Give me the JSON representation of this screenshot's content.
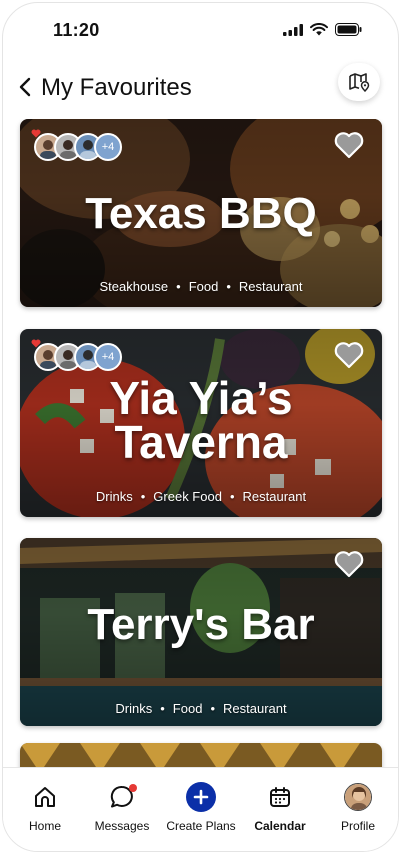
{
  "status_bar": {
    "time": "11:20"
  },
  "header": {
    "title": "My Favourites"
  },
  "cards": [
    {
      "name": "Texas BBQ",
      "tags": [
        "Steakhouse",
        "Food",
        "Restaurant"
      ],
      "avatar_more": "+4",
      "liked": true
    },
    {
      "name": "Yia Yia’s Taverna",
      "tags": [
        "Drinks",
        "Greek Food",
        "Restaurant"
      ],
      "avatar_more": "+4",
      "liked": true
    },
    {
      "name": "Terry's Bar",
      "tags": [
        "Drinks",
        "Food",
        "Restaurant"
      ],
      "liked": true
    }
  ],
  "nav": {
    "items": [
      {
        "label": "Home",
        "icon": "home-icon"
      },
      {
        "label": "Messages",
        "icon": "chat-icon"
      },
      {
        "label": "Create Plans",
        "icon": "plus-icon"
      },
      {
        "label": "Calendar",
        "icon": "calendar-icon"
      },
      {
        "label": "Profile",
        "icon": "avatar"
      }
    ]
  },
  "colors": {
    "accent": "#0b2fa8",
    "notification": "#e53935",
    "heart_avatar": "#e53935"
  }
}
